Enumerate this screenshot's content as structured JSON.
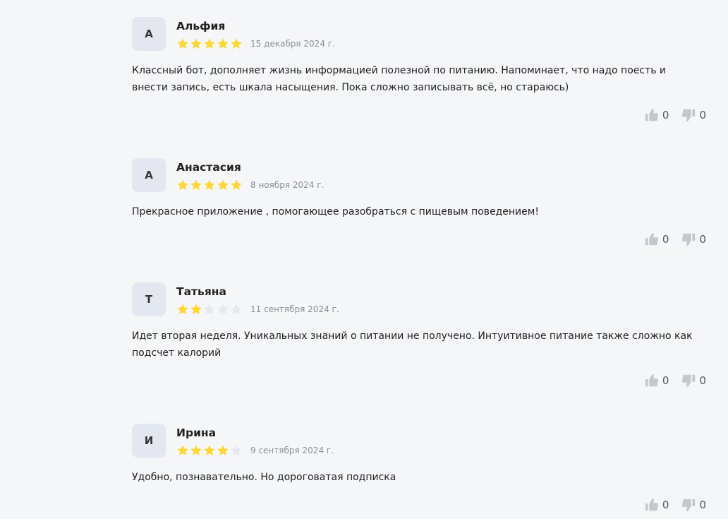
{
  "reviews": [
    {
      "initial": "А",
      "name": "Альфия",
      "rating": 5,
      "date": "15 декабря 2024 г.",
      "text": "Классный бот, дополняет жизнь информацией полезной по питанию. Напоминает, что надо поесть и внести запись, есть шкала насыщения. Пока сложно записывать всё, но стараюсь)",
      "likes": "0",
      "dislikes": "0"
    },
    {
      "initial": "А",
      "name": "Анастасия",
      "rating": 5,
      "date": "8 ноября 2024 г.",
      "text": "Прекрасное приложение , помогающее разобраться с пищевым поведением!",
      "likes": "0",
      "dislikes": "0"
    },
    {
      "initial": "Т",
      "name": "Татьяна",
      "rating": 2,
      "date": "11 сентября 2024 г.",
      "text": "Идет вторая неделя. Уникальных знаний о питании не получено. Интуитивное питание также сложно как подсчет калорий",
      "likes": "0",
      "dislikes": "0"
    },
    {
      "initial": "И",
      "name": "Ирина",
      "rating": 4,
      "date": "9 сентября 2024 г.",
      "text": "Удобно, познавательно. Но дороговатая подписка",
      "likes": "0",
      "dislikes": "0"
    }
  ],
  "colors": {
    "star_filled": "#fdd835",
    "star_empty": "#e5e9ef",
    "avatar_bg": "#e3e8f0",
    "vote_icon": "#c4c7cc"
  },
  "icons": {
    "star": "star-icon",
    "like": "thumbs-up-icon",
    "dislike": "thumbs-down-icon"
  }
}
